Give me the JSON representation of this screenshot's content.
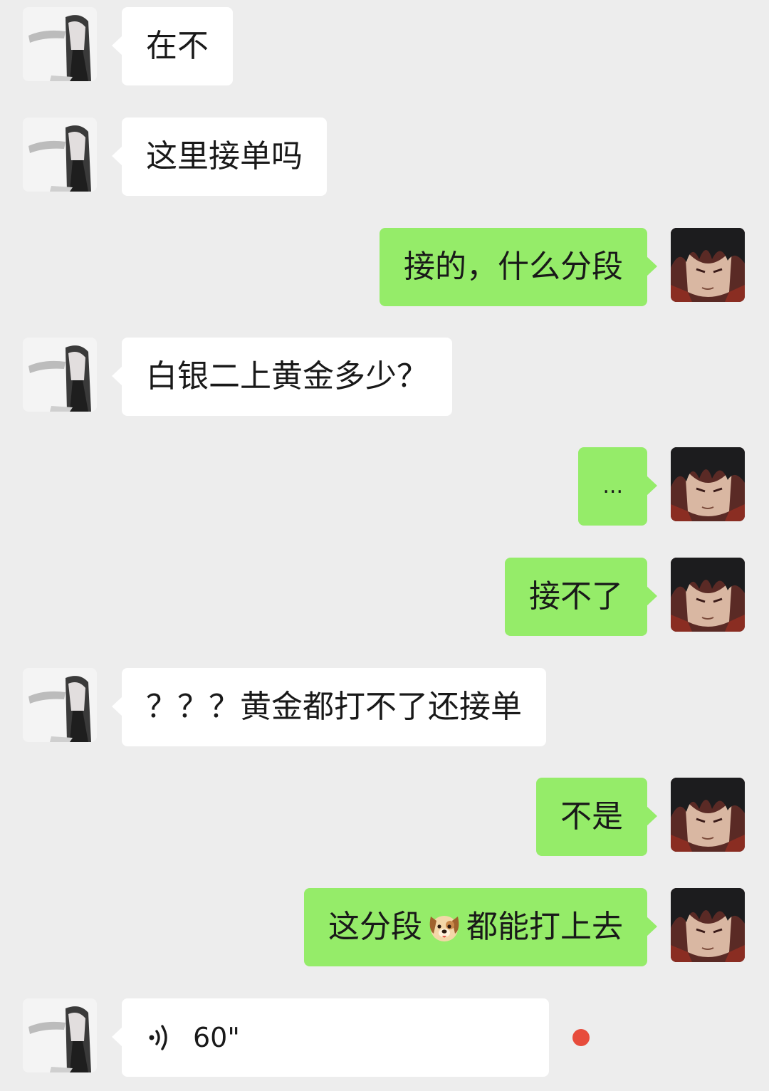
{
  "chat": {
    "messages": [
      {
        "side": "left",
        "text": "在不"
      },
      {
        "side": "left",
        "text": "这里接单吗"
      },
      {
        "side": "right",
        "text": "接的，什么分段"
      },
      {
        "side": "left",
        "text": "白银二上黄金多少？"
      },
      {
        "side": "right",
        "text": "..."
      },
      {
        "side": "right",
        "text": "接不了"
      },
      {
        "side": "left",
        "text": "？？？黄金都打不了还接单"
      },
      {
        "side": "right",
        "text": "不是"
      },
      {
        "side": "right",
        "text_before": "这分段",
        "emoji": "dog-face",
        "text_after": "都能打上去"
      },
      {
        "side": "left",
        "type": "voice",
        "duration": "60\"",
        "unread": true
      }
    ]
  },
  "colors": {
    "background": "#ededed",
    "incoming_bubble": "#ffffff",
    "outgoing_bubble": "#95ec69",
    "unread_dot": "#e74c3c"
  }
}
